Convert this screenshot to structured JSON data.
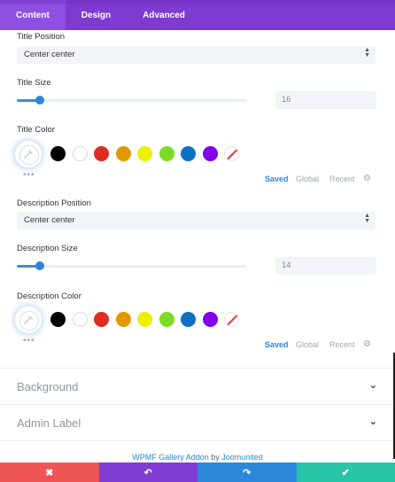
{
  "tabs": [
    {
      "label": "Content",
      "active": true
    },
    {
      "label": "Design",
      "active": false
    },
    {
      "label": "Advanced",
      "active": false
    }
  ],
  "title_position": {
    "label": "Title Position",
    "value": "Center center"
  },
  "title_size": {
    "label": "Title Size",
    "value": "16",
    "slider_fraction": 0.1
  },
  "title_color": {
    "label": "Title Color"
  },
  "description_position": {
    "label": "Description Position",
    "value": "Center center"
  },
  "description_size": {
    "label": "Description Size",
    "value": "14",
    "slider_fraction": 0.1
  },
  "description_color": {
    "label": "Description Color"
  },
  "swatches": [
    "#000000",
    "#ffffff",
    "#e02b20",
    "#e09900",
    "#edf000",
    "#7cda24",
    "#0c71c3",
    "#8300e9"
  ],
  "palette_links": {
    "saved": "Saved",
    "global": "Global",
    "recent": "Recent"
  },
  "more_dots": "•••",
  "sections": {
    "background": "Background",
    "admin_label": "Admin Label"
  },
  "footer": {
    "addon": "WPMF Gallery Addon",
    "by": " by ",
    "author": "Joomunited"
  },
  "actions": {
    "discard": "✖",
    "undo": "↶",
    "redo": "↷",
    "save": "✔"
  },
  "colors": {
    "tab_bar": "#7e3bd0",
    "accent": "#2b87da",
    "discard": "#ef5555",
    "save": "#29c4a9"
  }
}
